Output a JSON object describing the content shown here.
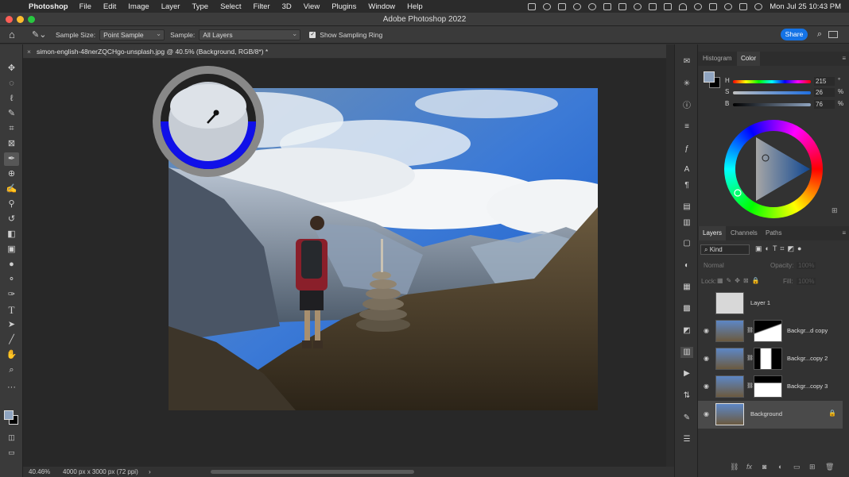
{
  "mac_menu": {
    "app": "Photoshop",
    "items": [
      "File",
      "Edit",
      "Image",
      "Layer",
      "Type",
      "Select",
      "Filter",
      "3D",
      "View",
      "Plugins",
      "Window",
      "Help"
    ],
    "datetime": "Mon Jul 25  10:43 PM"
  },
  "window": {
    "title": "Adobe Photoshop 2022"
  },
  "options": {
    "sample_size_label": "Sample Size:",
    "sample_size_value": "Point Sample",
    "sample_label": "Sample:",
    "sample_value": "All Layers",
    "sampling_ring_label": "Show Sampling Ring",
    "sampling_ring_checked": true,
    "share_label": "Share"
  },
  "document": {
    "tab_title": "simon-english-48nerZQCHgo-unsplash.jpg @ 40.5% (Background, RGB/8*) *",
    "zoom": "40.46%",
    "doc_info": "4000 px x 3000 px (72 ppi)"
  },
  "color_panel": {
    "tabs": [
      "Histogram",
      "Color"
    ],
    "active_tab": "Color",
    "h_label": "H",
    "h_value": "215",
    "h_unit": "°",
    "s_label": "S",
    "s_value": "26",
    "s_unit": "%",
    "b_label": "B",
    "b_value": "76",
    "b_unit": "%",
    "foreground": "#8fa4c0",
    "wheel_color": "#1b6fe0"
  },
  "layers_panel": {
    "tabs": [
      "Layers",
      "Channels",
      "Paths"
    ],
    "active_tab": "Layers",
    "filter_label": "Kind",
    "blend_mode": "Normal",
    "opacity_label": "Opacity:",
    "opacity_value": "100%",
    "lock_label": "Lock:",
    "fill_label": "Fill:",
    "fill_value": "100%",
    "layers": [
      {
        "name": "Layer 1",
        "visible": false
      },
      {
        "name": "Backgr...d copy",
        "visible": true
      },
      {
        "name": "Backgr...copy 2",
        "visible": true
      },
      {
        "name": "Backgr...copy 3",
        "visible": true
      },
      {
        "name": "Background",
        "visible": true,
        "selected": true,
        "locked": true
      }
    ]
  },
  "sampling_ring": {
    "new_color": "#1010e8",
    "current_color": "#222222"
  }
}
